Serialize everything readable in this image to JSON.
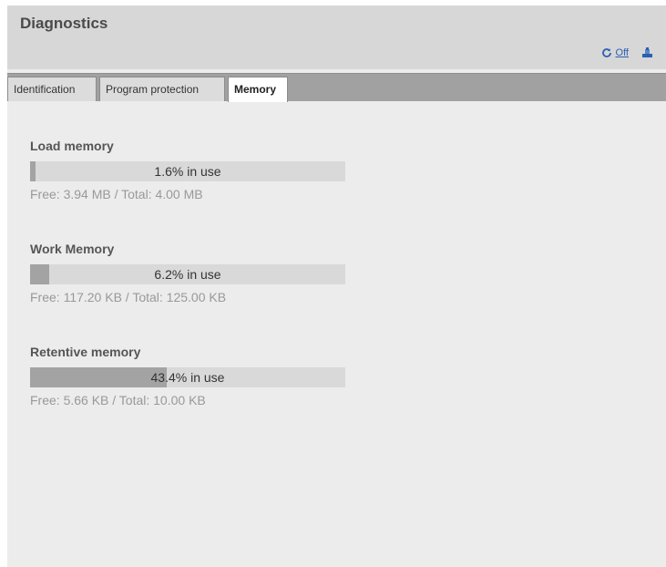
{
  "header": {
    "title": "Diagnostics",
    "refresh_icon": "refresh-icon",
    "off_label": "Off",
    "export_icon": "export-icon"
  },
  "tabs": [
    {
      "label": "Identification",
      "active": false
    },
    {
      "label": "Program protection",
      "active": false
    },
    {
      "label": "Memory",
      "active": true
    }
  ],
  "memory": [
    {
      "title": "Load memory",
      "percent_in_use": 1.6,
      "usage_label": "1.6% in use",
      "free_total": "Free: 3.94 MB / Total: 4.00 MB"
    },
    {
      "title": "Work Memory",
      "percent_in_use": 6.2,
      "usage_label": "6.2% in use",
      "free_total": "Free: 117.20 KB / Total: 125.00 KB"
    },
    {
      "title": "Retentive memory",
      "percent_in_use": 43.4,
      "usage_label": "43.4% in use",
      "free_total": "Free: 5.66 KB / Total: 10.00 KB"
    }
  ],
  "colors": {
    "header_bg": "#d7d7d7",
    "tabbar_bg": "#a1a1a1",
    "bar_track": "#d9d9d9",
    "bar_fill": "#a3a3a3",
    "link": "#2b5fb3"
  }
}
